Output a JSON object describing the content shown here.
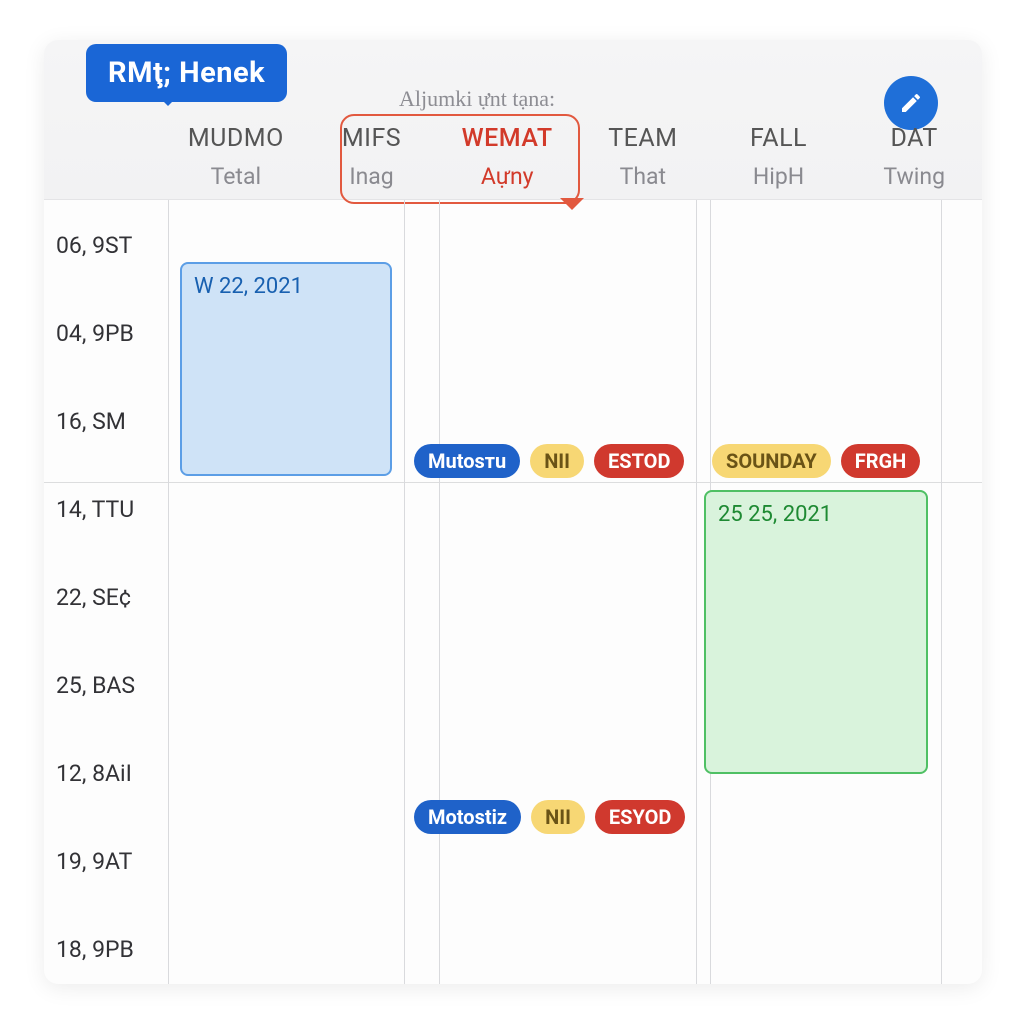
{
  "colors": {
    "brand_blue": "#1a66d6",
    "accent_red": "#d0392e",
    "event_blue_bg": "#cfe3f7",
    "event_green_bg": "#d9f3dc",
    "pill_yellow": "#f7d774"
  },
  "header": {
    "tooltip_label": "RMţ; Henek",
    "subtitle": "Aljumki ựnt tạna:",
    "edit_icon": "pencil-icon"
  },
  "days": [
    {
      "main": "MUDMO",
      "sub": "Tetal",
      "today": false
    },
    {
      "main": "MIFS",
      "sub": "Inag",
      "today": false
    },
    {
      "main": "WEMAT",
      "sub": "Aựny",
      "today": true
    },
    {
      "main": "TEAM",
      "sub": "That",
      "today": false
    },
    {
      "main": "FALL",
      "sub": "HipH",
      "today": false
    },
    {
      "main": "DAT",
      "sub": "Twing",
      "today": false
    }
  ],
  "time_slots": [
    "06, 9ST",
    "04, 9PB",
    "16, SM",
    "14, TTU",
    "22, SE¢",
    "25, BAS",
    "12, 8AiI",
    "19, 9AT",
    "18, 9PB"
  ],
  "events": {
    "blue_block": {
      "title": "W  22, 2021"
    },
    "green_block": {
      "title": "25  25, 2021"
    }
  },
  "pill_rows": {
    "row1": [
      {
        "label": "Mutosтu",
        "style": "blue"
      },
      {
        "label": "NII",
        "style": "yellow"
      },
      {
        "label": "ESTOD",
        "style": "red"
      },
      {
        "label": "SOUNDAY",
        "style": "yellow"
      },
      {
        "label": "FRGH",
        "style": "red"
      }
    ],
    "row2": [
      {
        "label": "Motostiz",
        "style": "blue"
      },
      {
        "label": "NII",
        "style": "yellow"
      },
      {
        "label": "ESYOD",
        "style": "red"
      }
    ]
  }
}
